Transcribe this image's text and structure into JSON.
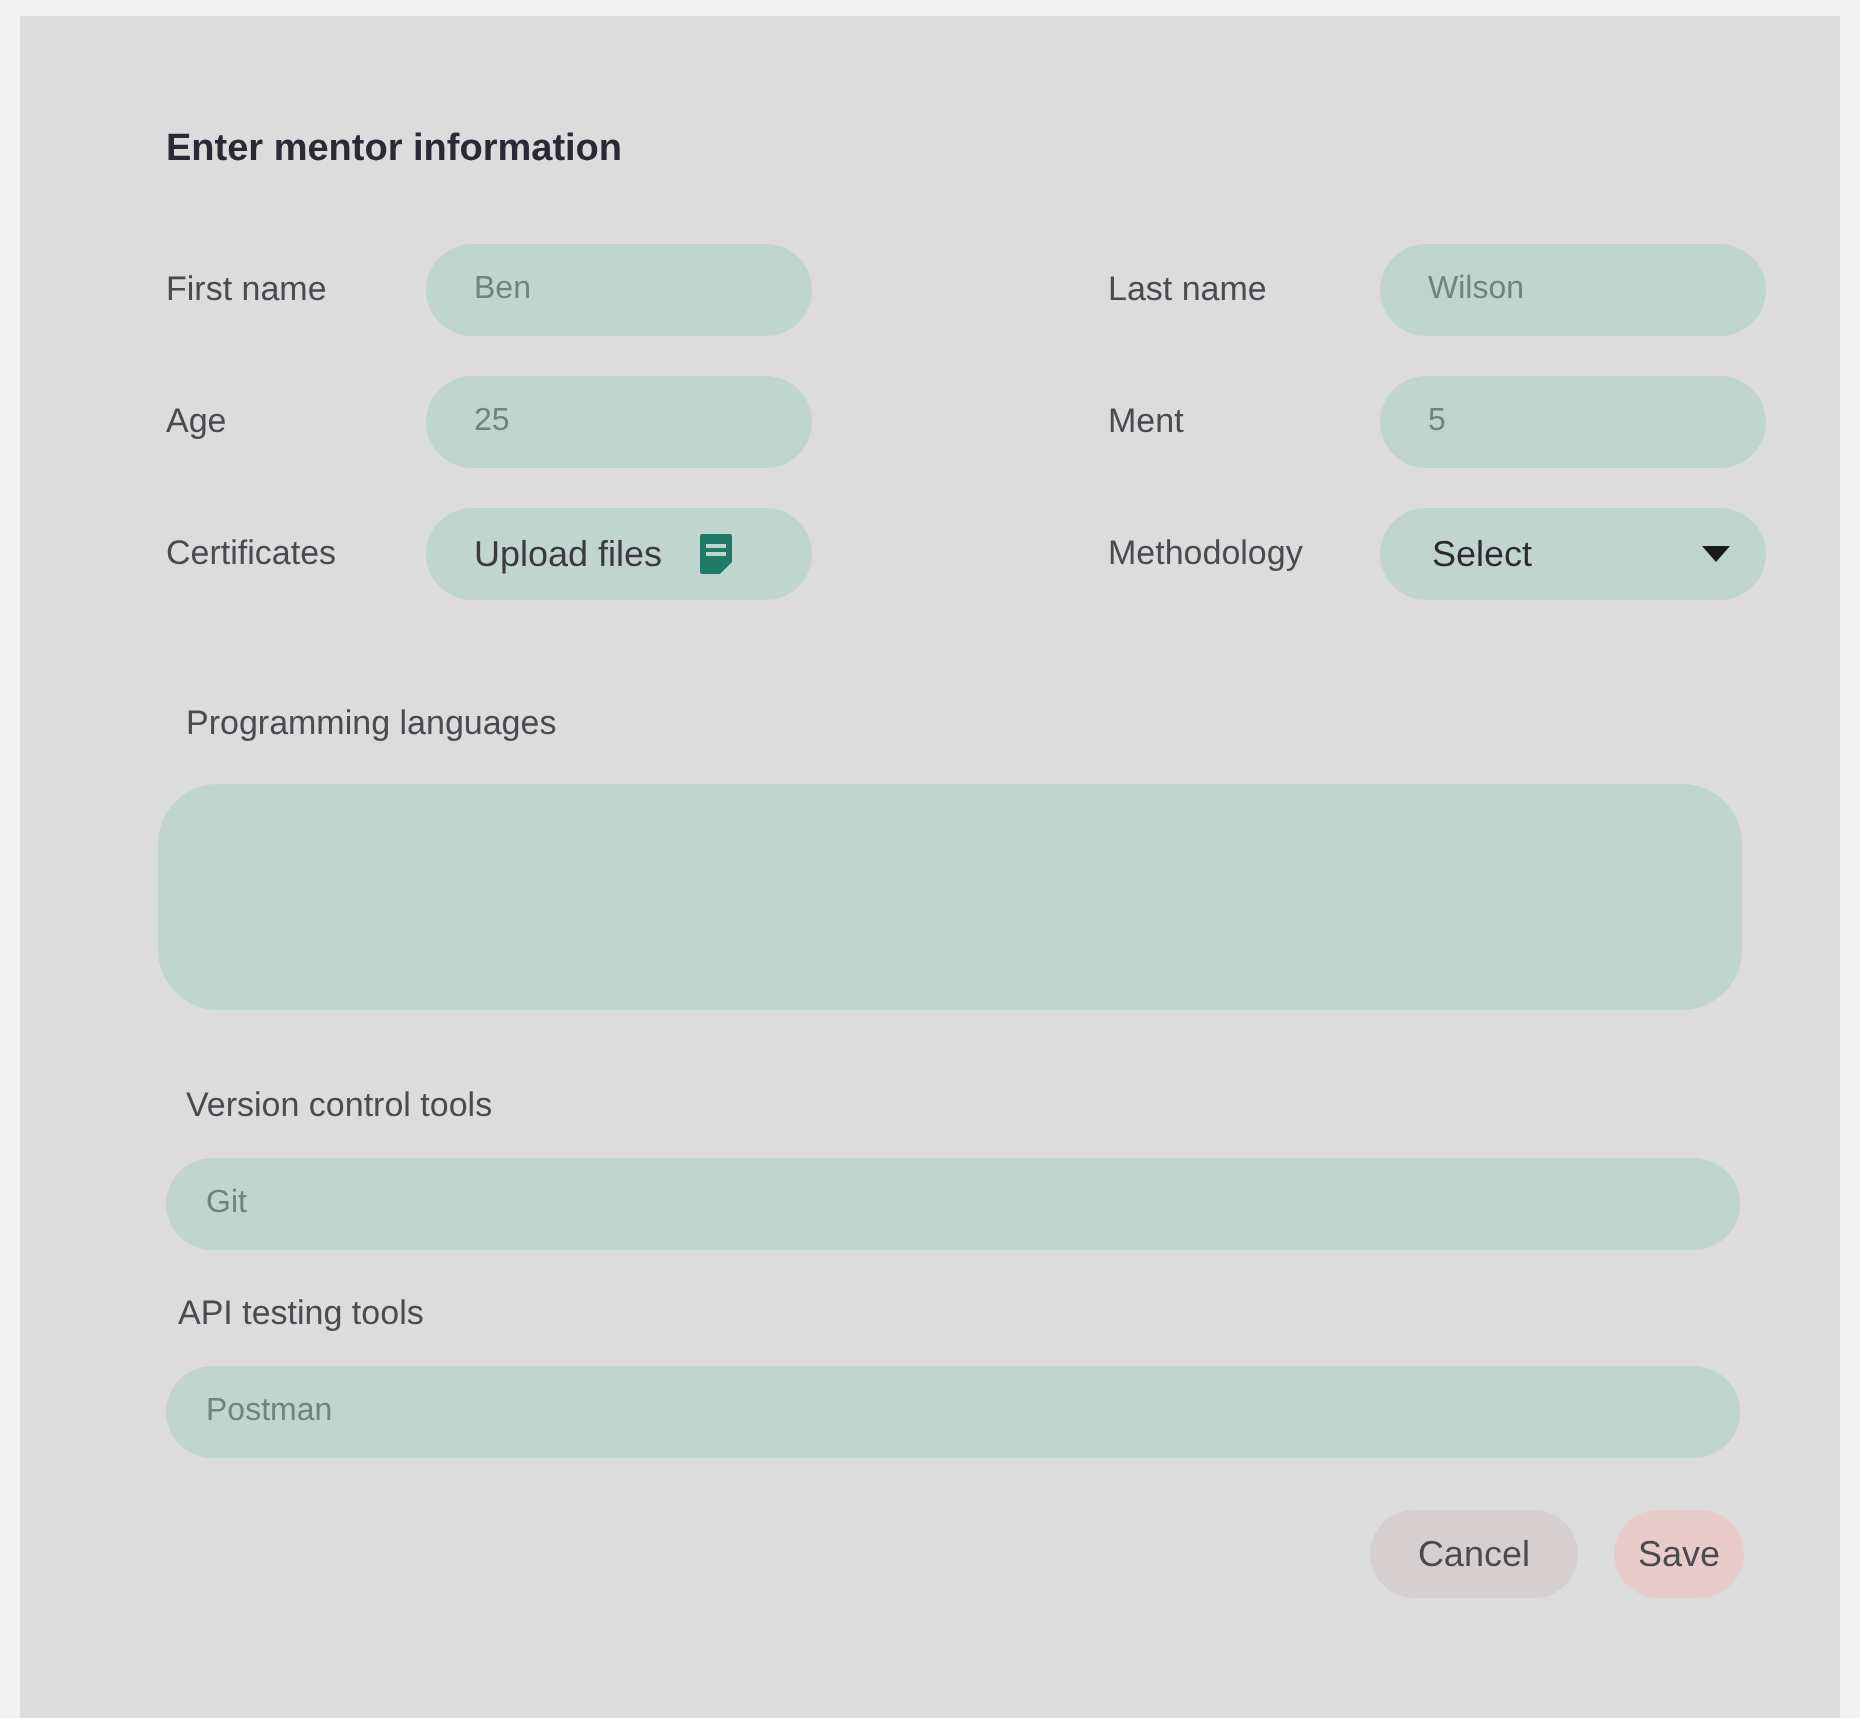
{
  "title": "Enter mentor information",
  "fields": [
    {
      "kind": "text",
      "label": "First name",
      "placeholder": "Ben"
    },
    {
      "kind": "text",
      "label": "Last name",
      "placeholder": "Wilson"
    },
    {
      "kind": "text",
      "label": "Age",
      "placeholder": "25"
    },
    {
      "kind": "text",
      "label": "Ment",
      "placeholder": "5"
    },
    {
      "kind": "upload",
      "label": "Certificates",
      "value": "Upload files"
    },
    {
      "kind": "select",
      "label": "Methodology",
      "value": "Select"
    }
  ],
  "wide_fields": [
    {
      "kind": "textarea",
      "label": "Programming languages"
    },
    {
      "kind": "text",
      "label": "Version control tools",
      "placeholder": "Git"
    },
    {
      "kind": "text",
      "label": "API testing tools",
      "placeholder": "Postman"
    }
  ],
  "buttons": [
    {
      "kind": "cancel",
      "label": "Cancel"
    },
    {
      "kind": "save",
      "label": "Save"
    }
  ]
}
